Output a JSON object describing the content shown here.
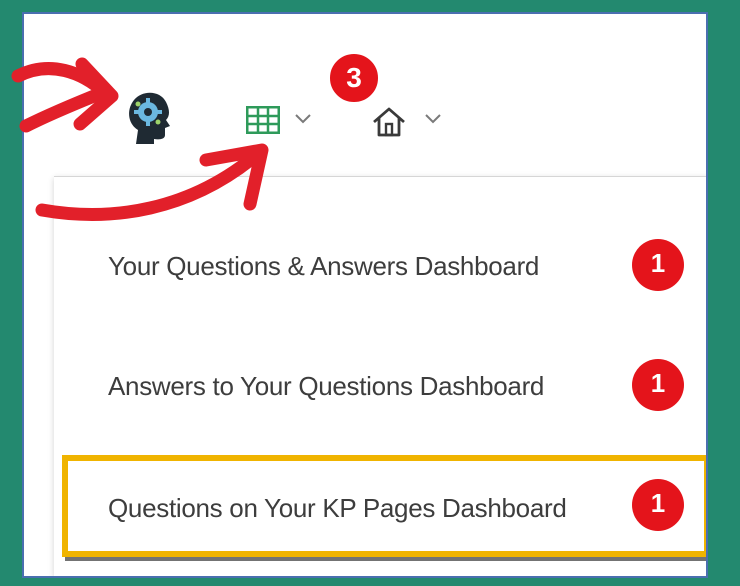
{
  "toolbar": {
    "icons": [
      "ai-head-gear-icon",
      "table-grid-icon",
      "home-icon"
    ],
    "notification_count": "3"
  },
  "menu": {
    "items": [
      {
        "label": "Your Questions & Answers Dashboard",
        "badge": "1",
        "highlighted": false
      },
      {
        "label": "Answers to Your Questions Dashboard",
        "badge": "1",
        "highlighted": false
      },
      {
        "label": "Questions on Your KP Pages Dashboard",
        "badge": "1",
        "highlighted": true
      }
    ]
  },
  "colors": {
    "background": "#23896f",
    "badge": "#e4141b",
    "highlight": "#f0b400",
    "arrow": "#e2202a",
    "grid_icon": "#2e9a5a"
  }
}
